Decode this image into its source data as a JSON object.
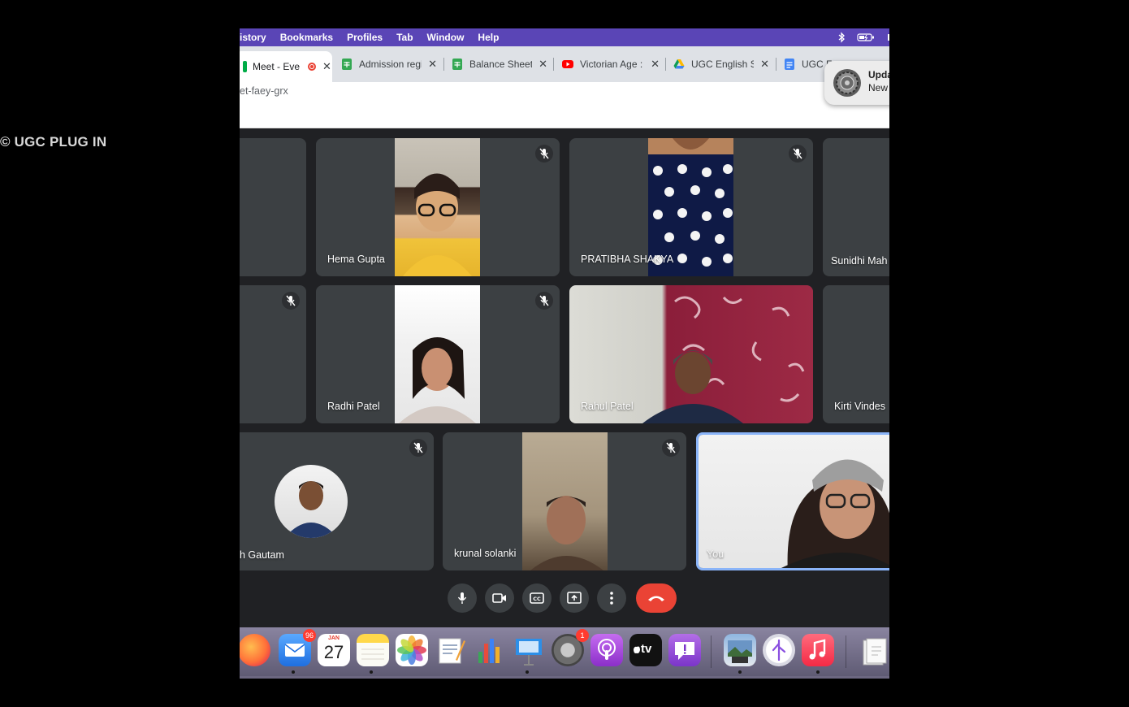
{
  "watermark": "© UGC PLUG IN",
  "menubar": {
    "items": [
      "istory",
      "Bookmarks",
      "Profiles",
      "Tab",
      "Window",
      "Help"
    ]
  },
  "tabs": [
    {
      "title": "Meet - Eve",
      "icon": "meet-icon",
      "active": true
    },
    {
      "title": "Admission regis",
      "icon": "sheets-icon"
    },
    {
      "title": "Balance Sheet -",
      "icon": "sheets-icon"
    },
    {
      "title": "Victorian Age : I",
      "icon": "youtube-icon"
    },
    {
      "title": "UGC English Sc",
      "icon": "drive-icon"
    },
    {
      "title": "UGC F",
      "icon": "docs-icon"
    }
  ],
  "address": {
    "url": "et-faey-grx"
  },
  "notification": {
    "title": "Upda",
    "subtitle": "New"
  },
  "participants": {
    "hema": "Hema Gupta",
    "pratibha": "PRATIBHA SHAKYA",
    "sunidhi": "Sunidhi Mah",
    "radhi": "Radhi Patel",
    "rahul": "Rahul Patel",
    "kirti": "Kirti Vindes",
    "gautam": "h Gautam",
    "krunal": "krunal solanki",
    "you": "You"
  },
  "dock": {
    "mail_badge": "96",
    "calendar_month": "JAN",
    "calendar_day": "27",
    "settings_badge": "1",
    "tv_label": "tv"
  },
  "colors": {
    "menubar": "#5a45b6",
    "meet_bg": "#202124",
    "tile_bg": "#3c4043",
    "end_call": "#ea4335",
    "you_border": "#8ab4f8"
  }
}
